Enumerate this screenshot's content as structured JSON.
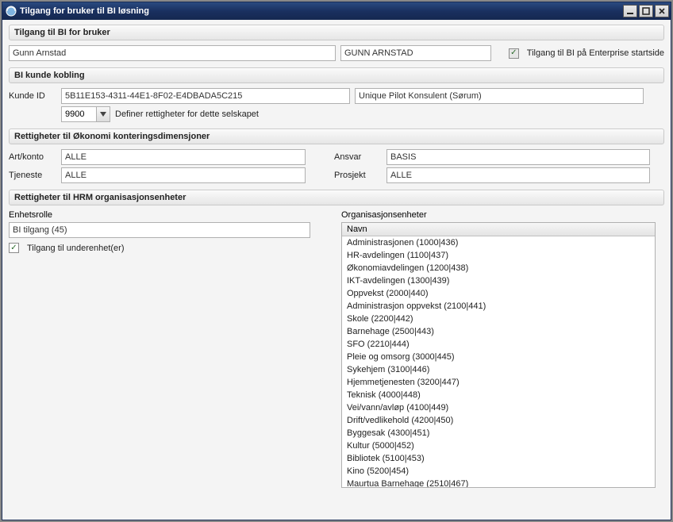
{
  "window": {
    "title": "Tilgang for bruker til BI løsning"
  },
  "group_user": {
    "title": "Tilgang til BI for bruker",
    "name_lower": "Gunn Arnstad",
    "name_upper": "GUNN ARNSTAD",
    "checkbox_label": "Tilgang til BI på Enterprise startside"
  },
  "group_kunde": {
    "title": "BI kunde kobling",
    "kunde_id_label": "Kunde ID",
    "kunde_id_value": "5B11E153-4311-44E1-8F02-E4DBADA5C215",
    "kunde_navn": "Unique Pilot Konsulent (Sørum)",
    "selskap_value": "9900",
    "definer_label": "Definer rettigheter for dette selskapet"
  },
  "group_okonomi": {
    "title": "Rettigheter til Økonomi konteringsdimensjoner",
    "art_label": "Art/konto",
    "art_value": "ALLE",
    "tjeneste_label": "Tjeneste",
    "tjeneste_value": "ALLE",
    "ansvar_label": "Ansvar",
    "ansvar_value": "BASIS",
    "prosjekt_label": "Prosjekt",
    "prosjekt_value": "ALLE"
  },
  "group_hrm": {
    "title": "Rettigheter til HRM organisasjonsenheter",
    "enhetsrolle_label": "Enhetsrolle",
    "enhetsrolle_value": "BI tilgang (45)",
    "underenhet_label": "Tilgang til underenhet(er)",
    "org_label": "Organisasjonsenheter",
    "org_head": "Navn",
    "org_rows": [
      "Administrasjonen (1000|436)",
      "HR-avdelingen (1100|437)",
      "Økonomiavdelingen (1200|438)",
      "IKT-avdelingen (1300|439)",
      "Oppvekst (2000|440)",
      "Administrasjon oppvekst (2100|441)",
      "Skole (2200|442)",
      "Barnehage (2500|443)",
      "SFO (2210|444)",
      "Pleie og omsorg (3000|445)",
      "Sykehjem (3100|446)",
      "Hjemmetjenesten (3200|447)",
      "Teknisk (4000|448)",
      "Vei/vann/avløp (4100|449)",
      "Drift/vedlikehold (4200|450)",
      "Byggesak (4300|451)",
      "Kultur (5000|452)",
      "Bibliotek (5100|453)",
      "Kino (5200|454)",
      "Maurtua Barnehage (2510|467)"
    ]
  }
}
